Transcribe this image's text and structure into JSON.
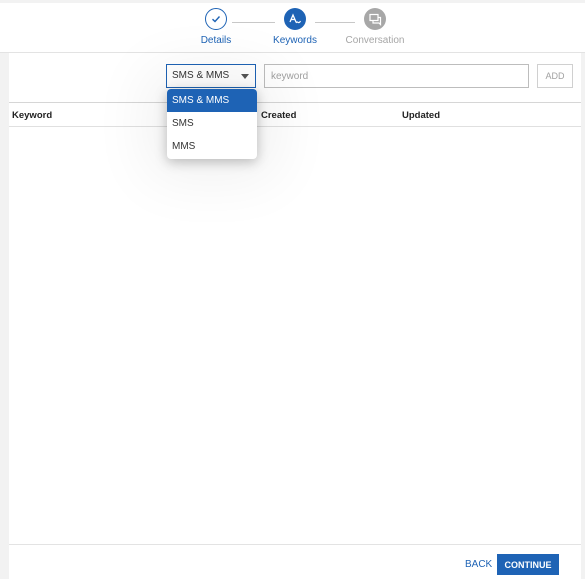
{
  "stepper": {
    "steps": [
      {
        "label": "Details",
        "state": "done",
        "icon": "check-icon"
      },
      {
        "label": "Keywords",
        "state": "active",
        "icon": "keywords-icon"
      },
      {
        "label": "Conversation",
        "state": "todo",
        "icon": "chat-icon"
      }
    ]
  },
  "toolbar": {
    "type_select_value": "SMS & MMS",
    "keyword_placeholder": "keyword",
    "add_label": "ADD"
  },
  "dropdown": {
    "options": [
      "SMS & MMS",
      "SMS",
      "MMS"
    ],
    "selected_index": 0
  },
  "table": {
    "columns": [
      "Keyword",
      "Created",
      "Updated"
    ],
    "rows": []
  },
  "footer": {
    "back_label": "BACK",
    "continue_label": "CONTINUE"
  },
  "colors": {
    "accent": "#1e63b5",
    "inactive": "#a7a7a7",
    "background": "#f2f2f2"
  }
}
